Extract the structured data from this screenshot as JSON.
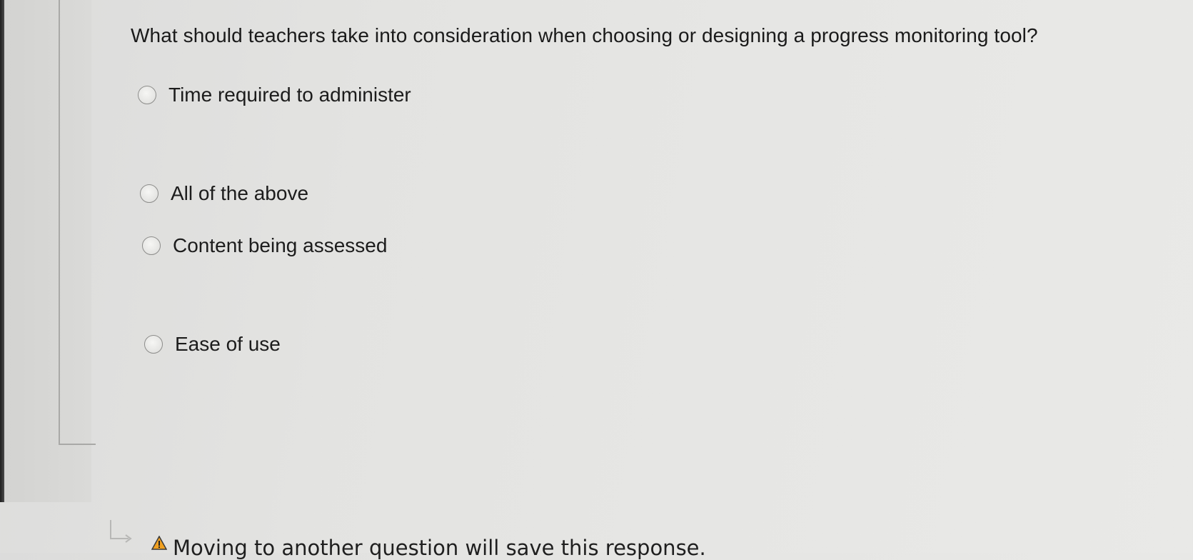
{
  "question": {
    "text": "What should teachers take into consideration when choosing or designing a progress monitoring tool?"
  },
  "options": [
    {
      "label": "Time required to administer",
      "selected": false
    },
    {
      "label": "All of the above",
      "selected": false
    },
    {
      "label": "Content being assessed",
      "selected": false
    },
    {
      "label": "Ease of use",
      "selected": false
    }
  ],
  "footer": {
    "notice": "Moving to another question will save this response.",
    "icons": [
      "return-arrow-icon",
      "warning-icon"
    ]
  },
  "colors": {
    "background": "#e5e5e3",
    "text": "#1c1c1c",
    "radio_border": "#8d8d8b",
    "warning": "#f0a020"
  }
}
